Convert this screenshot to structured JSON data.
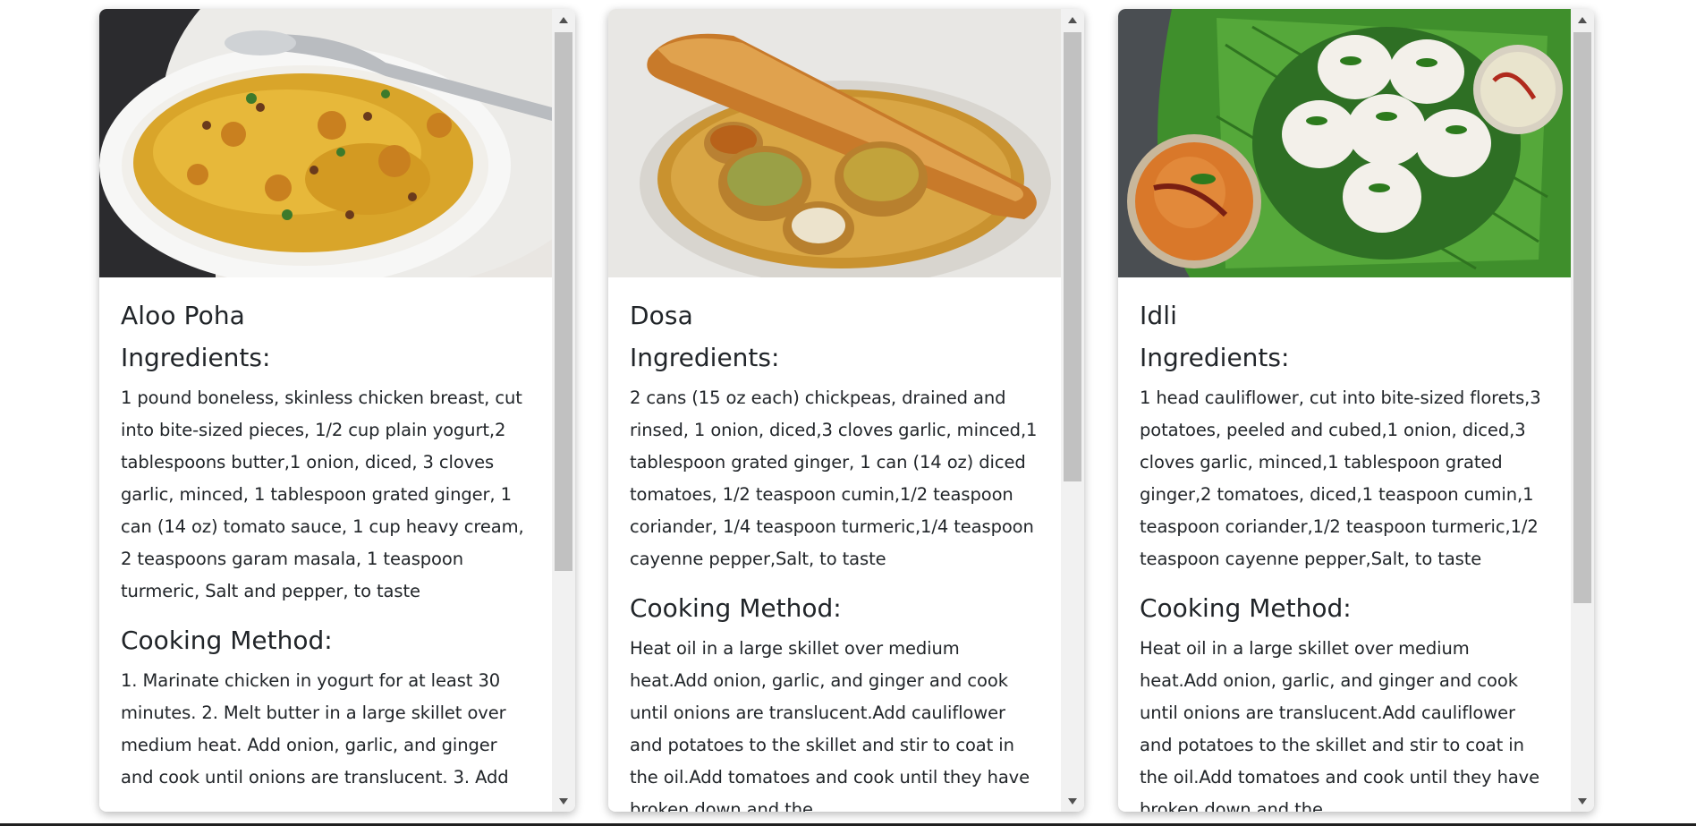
{
  "recipes": [
    {
      "name": "Aloo Poha",
      "ingredients_heading": "Ingredients:",
      "ingredients": "1 pound boneless, skinless chicken breast, cut into bite-sized pieces, 1/2 cup plain yogurt,2 tablespoons butter,1 onion, diced, 3 cloves garlic, minced, 1 tablespoon grated ginger, 1 can (14 oz) tomato sauce, 1 cup heavy cream, 2 teaspoons garam masala, 1 teaspoon turmeric, Salt and pepper, to taste",
      "method_heading": "Cooking Method:",
      "method": "1. Marinate chicken in yogurt for at least 30 minutes. 2. Melt butter in a large skillet over medium heat. Add onion, garlic, and ginger and cook until onions are translucent. 3. Add"
    },
    {
      "name": "Dosa",
      "ingredients_heading": "Ingredients:",
      "ingredients": "2 cans (15 oz each) chickpeas, drained and rinsed, 1 onion, diced,3 cloves garlic, minced,1 tablespoon grated ginger, 1 can (14 oz) diced tomatoes, 1/2 teaspoon cumin,1/2 teaspoon coriander, 1/4 teaspoon turmeric,1/4 teaspoon cayenne pepper,Salt, to taste",
      "method_heading": "Cooking Method:",
      "method": "Heat oil in a large skillet over medium heat.Add onion, garlic, and ginger and cook until onions are translucent.Add cauliflower and potatoes to the skillet and stir to coat in the oil.Add tomatoes and cook until they have broken down and the"
    },
    {
      "name": "Idli",
      "ingredients_heading": "Ingredients:",
      "ingredients": "1 head cauliflower, cut into bite-sized florets,3 potatoes, peeled and cubed,1 onion, diced,3 cloves garlic, minced,1 tablespoon grated ginger,2 tomatoes, diced,1 teaspoon cumin,1 teaspoon coriander,1/2 teaspoon turmeric,1/2 teaspoon cayenne pepper,Salt, to taste",
      "method_heading": "Cooking Method:",
      "method": "Heat oil in a large skillet over medium heat.Add onion, garlic, and ginger and cook until onions are translucent.Add cauliflower and potatoes to the skillet and stir to coat in the oil.Add tomatoes and cook until they have broken down and the"
    }
  ],
  "scroll_positions": [
    0.0,
    0.0,
    0.0
  ]
}
